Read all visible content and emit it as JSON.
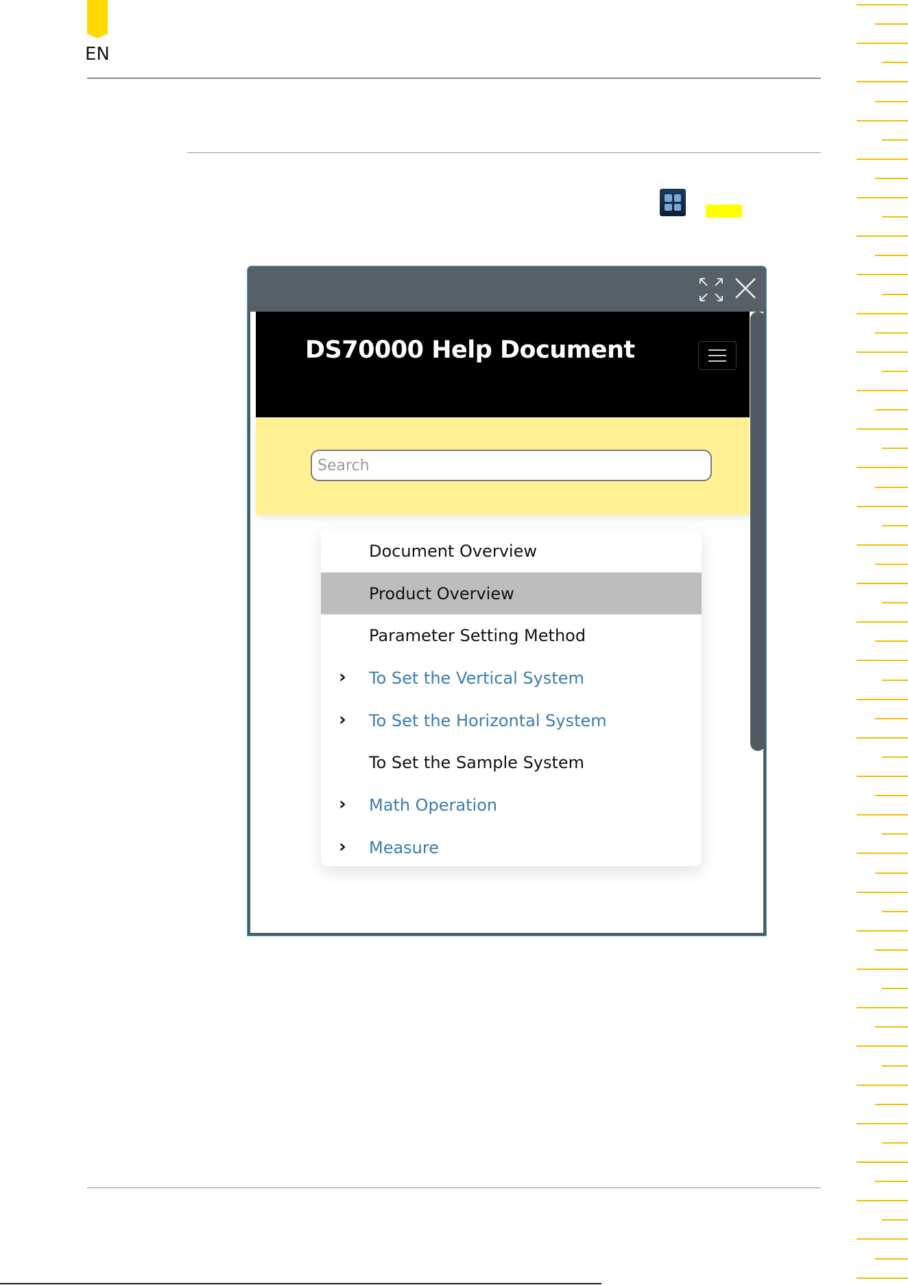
{
  "page": {
    "language_tag": "EN"
  },
  "help_window": {
    "title": "DS70000 Help Document",
    "search": {
      "placeholder": "Search",
      "value": ""
    },
    "toc": [
      {
        "label": "Document Overview",
        "expandable": false,
        "link": false,
        "active": false
      },
      {
        "label": "Product Overview",
        "expandable": false,
        "link": false,
        "active": true
      },
      {
        "label": "Parameter Setting Method",
        "expandable": false,
        "link": false,
        "active": false
      },
      {
        "label": "To Set the Vertical System",
        "expandable": true,
        "link": true,
        "active": false
      },
      {
        "label": "To Set the Horizontal System",
        "expandable": true,
        "link": true,
        "active": false
      },
      {
        "label": "To Set the Sample System",
        "expandable": false,
        "link": false,
        "active": false
      },
      {
        "label": "Math Operation",
        "expandable": true,
        "link": true,
        "active": false
      },
      {
        "label": "Measure",
        "expandable": true,
        "link": true,
        "active": false
      }
    ],
    "scroll_position": 0
  },
  "icons": {
    "tab_marker": "language-tab-marker",
    "app_icon": "help-app-icon",
    "expand": "expand-icon",
    "close": "close-icon",
    "menu": "hamburger-menu-icon",
    "chevron": "chevron-right-icon"
  },
  "colors": {
    "accent_yellow": "#ffd800",
    "highlight": "#ffff00",
    "search_band": "#fff193",
    "window_frame": "#566066",
    "link": "#3b7bb0",
    "active_row": "#bdbdbd"
  }
}
